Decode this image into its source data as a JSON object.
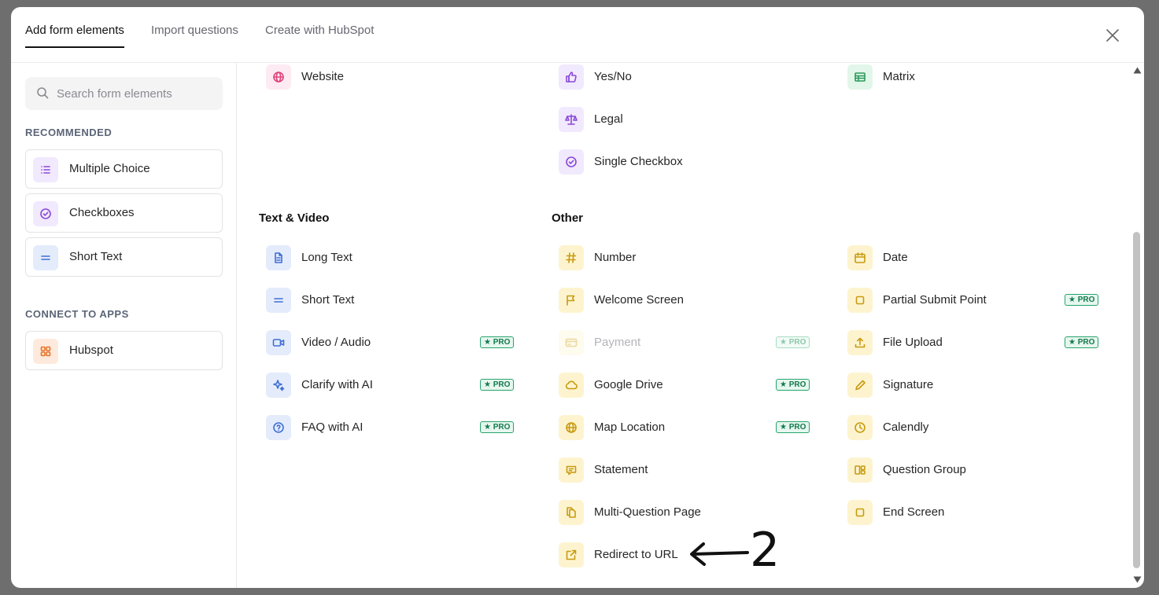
{
  "tabs": [
    {
      "label": "Add form elements",
      "active": true
    },
    {
      "label": "Import questions",
      "active": false
    },
    {
      "label": "Create with HubSpot",
      "active": false
    }
  ],
  "close_icon": "close-icon",
  "sidebar": {
    "search_placeholder": "Search form elements",
    "recommended_label": "RECOMMENDED",
    "recommended": [
      {
        "label": "Multiple Choice",
        "icon": "list-icon",
        "color": "purple"
      },
      {
        "label": "Checkboxes",
        "icon": "check-circle-icon",
        "color": "purple"
      },
      {
        "label": "Short Text",
        "icon": "equals-icon",
        "color": "blue"
      }
    ],
    "connect_label": "CONNECT TO APPS",
    "apps": [
      {
        "label": "Hubspot",
        "icon": "grid-icon",
        "color": "orange"
      }
    ]
  },
  "main": {
    "top_col1": [
      {
        "label": "Website",
        "icon": "globe-icon",
        "color": "pink"
      }
    ],
    "top_col2": [
      {
        "label": "Yes/No",
        "icon": "thumbs-up-icon",
        "color": "purple"
      },
      {
        "label": "Legal",
        "icon": "scale-icon",
        "color": "purple"
      },
      {
        "label": "Single Checkbox",
        "icon": "check-circle-icon",
        "color": "purple"
      }
    ],
    "top_col3": [
      {
        "label": "Matrix",
        "icon": "table-icon",
        "color": "green"
      }
    ],
    "text_video": {
      "heading": "Text & Video",
      "items": [
        {
          "label": "Long Text",
          "icon": "document-icon",
          "pro": false
        },
        {
          "label": "Short Text",
          "icon": "equals-icon",
          "pro": false
        },
        {
          "label": "Video / Audio",
          "icon": "video-icon",
          "pro": true
        },
        {
          "label": "Clarify with AI",
          "icon": "sparkle-icon",
          "pro": true
        },
        {
          "label": "FAQ with AI",
          "icon": "question-icon",
          "pro": true
        }
      ]
    },
    "other": {
      "heading": "Other",
      "col_left": [
        {
          "label": "Number",
          "icon": "hash-icon",
          "pro": false
        },
        {
          "label": "Welcome Screen",
          "icon": "flag-icon",
          "pro": false
        },
        {
          "label": "Payment",
          "icon": "card-icon",
          "pro": true,
          "disabled": true
        },
        {
          "label": "Google Drive",
          "icon": "cloud-icon",
          "pro": true
        },
        {
          "label": "Map Location",
          "icon": "globe-icon",
          "pro": true
        },
        {
          "label": "Statement",
          "icon": "chat-icon",
          "pro": false
        },
        {
          "label": "Multi-Question Page",
          "icon": "pages-icon",
          "pro": false
        },
        {
          "label": "Redirect to URL",
          "icon": "external-link-icon",
          "pro": false
        }
      ],
      "col_right": [
        {
          "label": "Date",
          "icon": "calendar-icon",
          "pro": false
        },
        {
          "label": "Partial Submit Point",
          "icon": "square-icon",
          "pro": true
        },
        {
          "label": "File Upload",
          "icon": "upload-icon",
          "pro": true
        },
        {
          "label": "Signature",
          "icon": "pen-icon",
          "pro": false
        },
        {
          "label": "Calendly",
          "icon": "clock-icon",
          "pro": false
        },
        {
          "label": "Question Group",
          "icon": "group-icon",
          "pro": false
        },
        {
          "label": "End Screen",
          "icon": "square-icon",
          "pro": false
        }
      ]
    },
    "pro_badge": "★ PRO",
    "annotation_number": "2"
  },
  "colors": {
    "pro_border": "#27a36b",
    "pro_bg": "#e6f7ef",
    "tab_active": "#111111"
  }
}
